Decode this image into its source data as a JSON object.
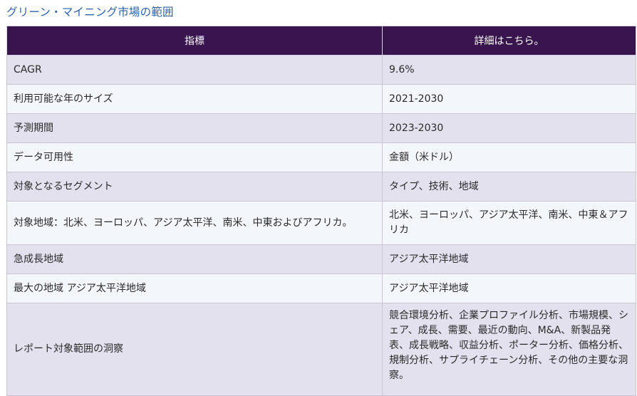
{
  "heading": "グリーン・マイニング市場の範囲",
  "table": {
    "headers": [
      "指標",
      "詳細はこちら。"
    ],
    "rows": [
      {
        "label": "CAGR",
        "value": "9.6%"
      },
      {
        "label": "利用可能な年のサイズ",
        "value": "2021-2030"
      },
      {
        "label": "予測期間",
        "value": "2023-2030"
      },
      {
        "label": "データ可用性",
        "value": "金額（米ドル）"
      },
      {
        "label": "対象となるセグメント",
        "value": "タイプ、技術、地域"
      },
      {
        "label": "対象地域：北米、ヨーロッパ、アジア太平洋、南米、中東およびアフリカ。",
        "value": "北米、ヨーロッパ、アジア太平洋、南米、中東＆アフリカ"
      },
      {
        "label": "急成長地域",
        "value": "アジア太平洋地域"
      },
      {
        "label": "最大の地域 アジア太平洋地域",
        "value": "アジア太平洋地域"
      },
      {
        "label": "レポート対象範囲の洞察",
        "value": "競合環境分析、企業プロファイル分析、市場規模、シェア、成長、需要、最近の動向、M&A、新製品発表、成長戦略、収益分析、ポーター分析、価格分析、規制分析、サプライチェーン分析、その他の主要な洞察。"
      }
    ]
  }
}
